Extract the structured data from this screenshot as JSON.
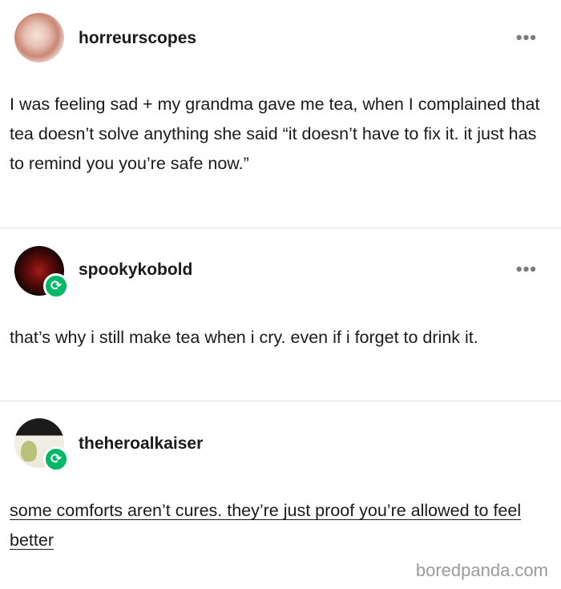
{
  "posts": [
    {
      "username": "horreurscopes",
      "text": "I was feeling sad + my grandma gave me tea, when I complained that tea doesn’t solve anything she said “it doesn’t have to fix it. it just has to remind you you’re safe now.”",
      "reblogged": false,
      "menu_icon": "•••"
    },
    {
      "username": "spookykobold",
      "text": "that’s why i still make tea when i cry. even if i forget to drink it.",
      "reblogged": true,
      "menu_icon": "•••"
    },
    {
      "username": "theheroalkaiser",
      "text": "some comforts aren’t cures. they’re just proof you’re allowed to feel better",
      "reblogged": true
    }
  ],
  "reblog_icon": "⟳",
  "watermark": "boredpanda.com",
  "colors": {
    "reblog_badge": "#00b866",
    "divider": "#dcdcdc",
    "text": "#1a1a1a",
    "menu_dots": "#7b7b7b"
  }
}
